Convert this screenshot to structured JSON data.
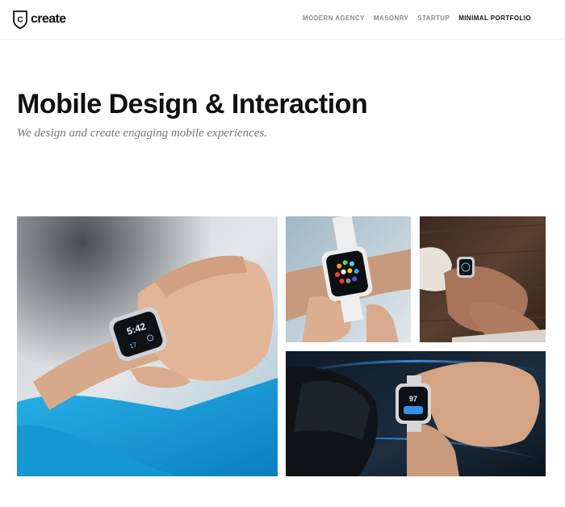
{
  "header": {
    "logo": {
      "mark": "C",
      "text": "create"
    },
    "nav": [
      {
        "label": "MODERN AGENCY",
        "active": false
      },
      {
        "label": "MASONRY",
        "active": false
      },
      {
        "label": "STARTUP",
        "active": false
      },
      {
        "label": "MINIMAL PORTFOLIO",
        "active": true
      }
    ]
  },
  "hero": {
    "title": "Mobile Design & Interaction",
    "subtitle": "We design and create engaging mobile experiences."
  },
  "gallery": {
    "watch_faces": {
      "large": {
        "line1": "5:42",
        "line2": "17"
      },
      "car": {
        "line1": "97"
      }
    }
  },
  "colors": {
    "accent_blue": "#1c9fd8",
    "nav_inactive": "#8a8a8a",
    "nav_active": "#111111",
    "subtitle_gray": "#777777"
  }
}
